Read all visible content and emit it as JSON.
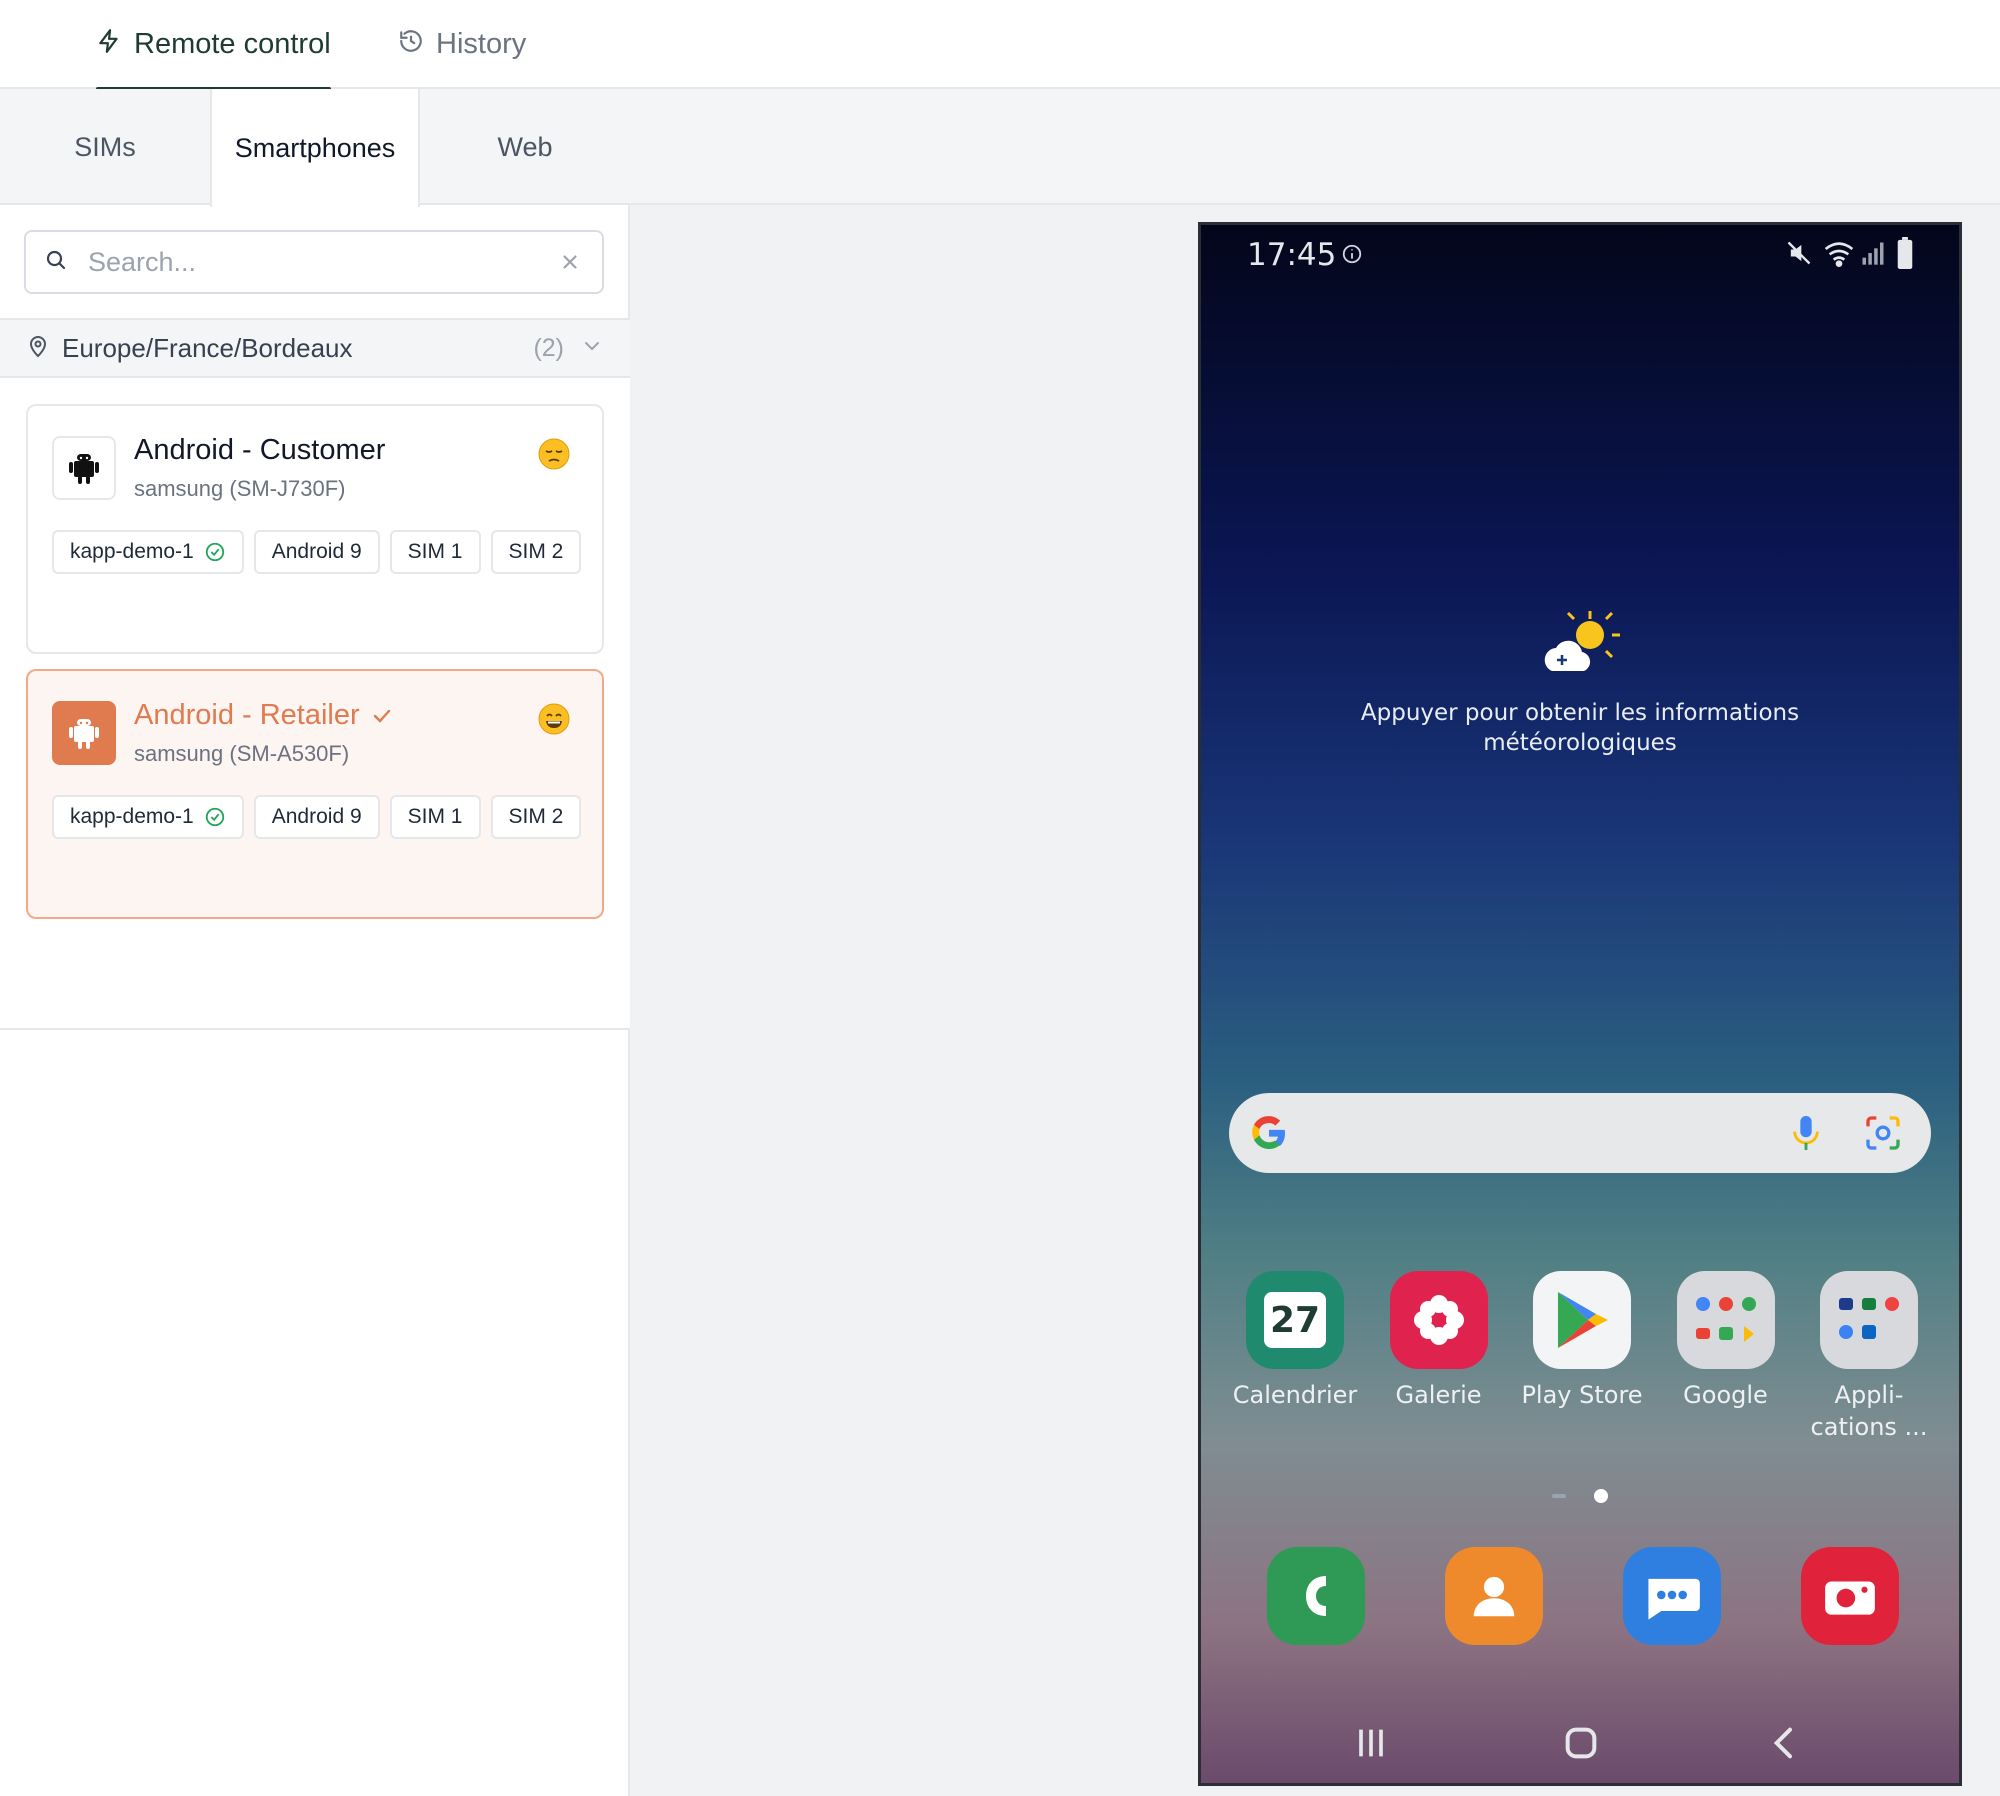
{
  "topnav": {
    "remote_label": "Remote control",
    "history_label": "History"
  },
  "subtabs": [
    "SIMs",
    "Smartphones",
    "Web"
  ],
  "search": {
    "placeholder": "Search..."
  },
  "group": {
    "title": "Europe/France/Bordeaux",
    "count": "(2)"
  },
  "devices": [
    {
      "name": "Android - Customer",
      "model": "samsung (SM-J730F)",
      "selected": false,
      "tags": [
        "kapp-demo-1",
        "Android 9",
        "SIM 1",
        "SIM 2"
      ]
    },
    {
      "name": "Android - Retailer",
      "model": "samsung (SM-A530F)",
      "selected": true,
      "tags": [
        "kapp-demo-1",
        "Android 9",
        "SIM 1",
        "SIM 2"
      ]
    }
  ],
  "phone": {
    "time": "17:45",
    "weather_line1": "Appuyer pour obtenir les informations",
    "weather_line2": "météorologiques",
    "apps": [
      "Calendrier",
      "Galerie",
      "Play Store",
      "Google",
      "Appli-",
      "cations ..."
    ],
    "calendar_day": "27"
  },
  "colors": {
    "accent": "#1f3b34",
    "selected": "#e07a4f",
    "success": "#22a65a"
  }
}
